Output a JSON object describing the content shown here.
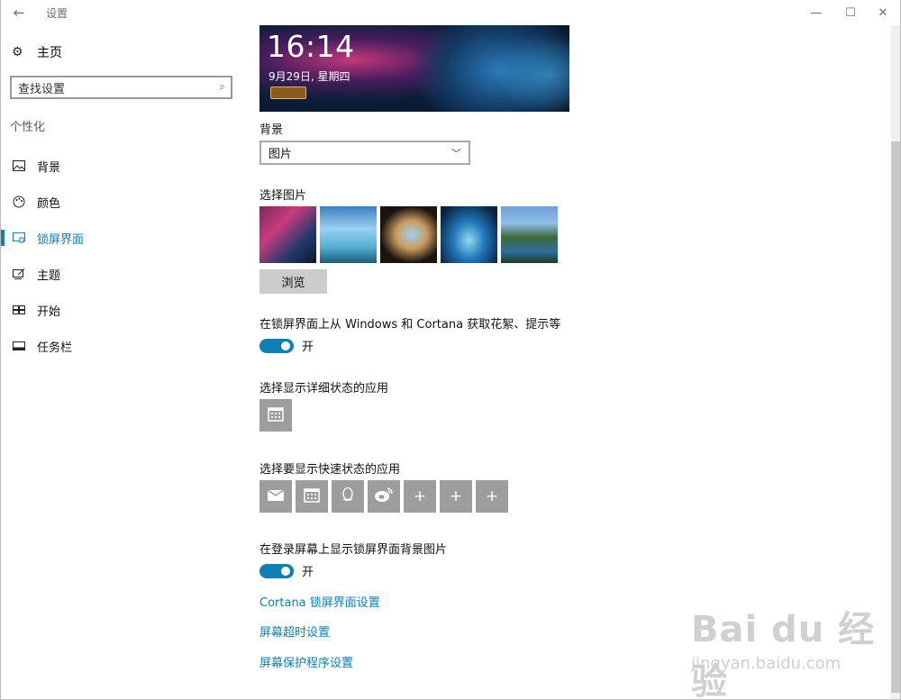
{
  "window": {
    "title": "设置",
    "back_glyph": "←",
    "minimize_glyph": "—",
    "maximize_glyph": "☐",
    "close_glyph": "✕"
  },
  "sidebar": {
    "home_label": "主页",
    "search_placeholder": "查找设置",
    "section_title": "个性化",
    "items": [
      {
        "label": "背景",
        "icon": "image-icon",
        "glyph": "▭"
      },
      {
        "label": "颜色",
        "icon": "palette-icon",
        "glyph": "◍"
      },
      {
        "label": "锁屏界面",
        "icon": "lock-screen-icon",
        "glyph": "▭",
        "active": true
      },
      {
        "label": "主题",
        "icon": "theme-icon",
        "glyph": "✎"
      },
      {
        "label": "开始",
        "icon": "start-icon",
        "glyph": "☷"
      },
      {
        "label": "任务栏",
        "icon": "taskbar-icon",
        "glyph": "▭"
      }
    ]
  },
  "main": {
    "preview": {
      "time": "16:14",
      "date": "9月29日, 星期四"
    },
    "background_label": "背景",
    "background_value": "图片",
    "choose_picture_label": "选择图片",
    "browse_label": "浏览",
    "fun_facts_label": "在锁屏界面上从 Windows 和 Cortana 获取花絮、提示等",
    "fun_facts_state": "开",
    "detailed_status_label": "选择显示详细状态的应用",
    "quick_status_label": "选择要显示快速状态的应用",
    "quick_status_apps": [
      {
        "icon": "mail-icon",
        "glyph": "✉"
      },
      {
        "icon": "calendar-icon",
        "glyph": "▦"
      },
      {
        "icon": "qq-icon",
        "glyph": "♙"
      },
      {
        "icon": "weibo-icon",
        "glyph": "◉"
      },
      {
        "icon": "add-icon",
        "glyph": "+"
      },
      {
        "icon": "add-icon",
        "glyph": "+"
      },
      {
        "icon": "add-icon",
        "glyph": "+"
      }
    ],
    "signin_bg_label": "在登录屏幕上显示锁屏界面背景图片",
    "signin_bg_state": "开",
    "links": [
      "Cortana 锁屏界面设置",
      "屏幕超时设置",
      "屏幕保护程序设置"
    ]
  },
  "watermark": {
    "brand": "Bai du 经验",
    "url": "jingyan.baidu.com"
  }
}
